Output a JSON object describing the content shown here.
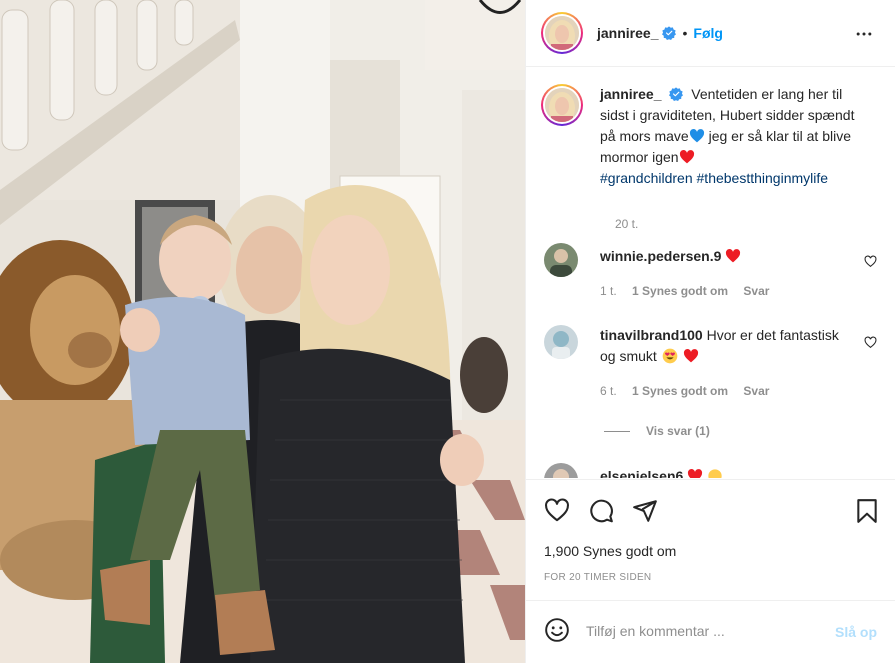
{
  "colors": {
    "accent": "#0095f6",
    "text": "#262626",
    "muted": "#8e8e8e",
    "hashtag": "#00376b",
    "heart": "#ed4956",
    "blue_heart": "#1f8ee6",
    "post_disabled": "#b2dffc"
  },
  "header": {
    "username": "janniree_",
    "follow_label": "Følg",
    "separator": "•",
    "more_icon": "more-horizontal-icon"
  },
  "caption": {
    "username": "janniree_",
    "text_1": "Ventetiden er lang her til sidst i graviditeten, Hubert sidder spændt på mors mave",
    "text_2": " jeg er så klar til at blive mormor igen",
    "hashtag_1": "#grandchildren",
    "hashtag_2": "#thebestthinginmylife",
    "time": "20 t."
  },
  "comments": [
    {
      "username": "winnie.pedersen.9",
      "text": "",
      "time": "1 t.",
      "likes": "1 Synes godt om",
      "reply": "Svar"
    },
    {
      "username": "tinavilbrand100",
      "text": "Hvor er det fantastisk og smukt",
      "time": "6 t.",
      "likes": "1 Synes godt om",
      "reply": "Svar",
      "view_replies": "Vis svar (1)"
    },
    {
      "username": "elsenielsen6",
      "text": ""
    }
  ],
  "actions": {
    "like_icon": "heart-icon",
    "comment_icon": "comment-icon",
    "share_icon": "share-icon",
    "save_icon": "bookmark-icon",
    "likes_count": "1,900 Synes godt om",
    "posted_ago": "FOR 20 TIMER SIDEN"
  },
  "add_comment": {
    "placeholder": "Tilføj en kommentar ...",
    "post_label": "Slå op"
  }
}
